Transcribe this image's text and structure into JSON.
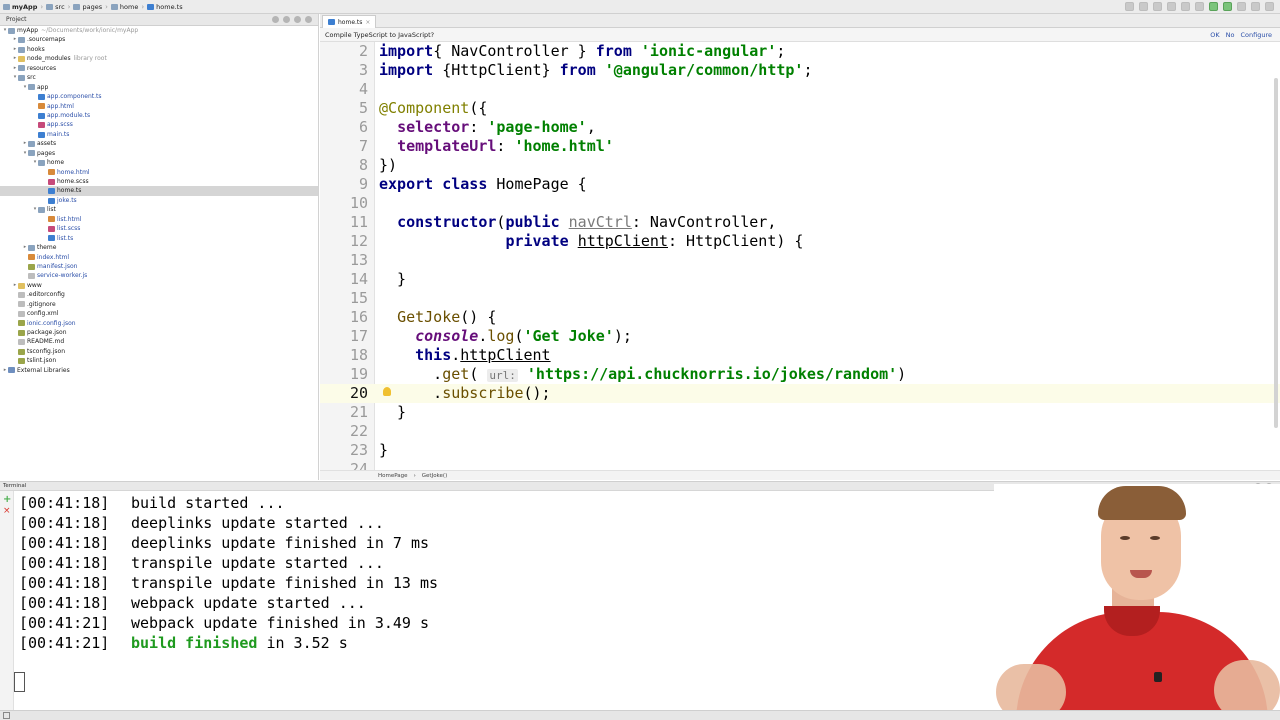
{
  "breadcrumb": [
    "myApp",
    "src",
    "pages",
    "home",
    "home.ts"
  ],
  "project": {
    "header": "Project",
    "tree": [
      {
        "label": "myApp",
        "sub": "~/Documents/work/ionic/myApp",
        "indent": 0,
        "arrow": "▾",
        "icon": "folder"
      },
      {
        "label": ".sourcemaps",
        "indent": 1,
        "arrow": "▸",
        "icon": "folder"
      },
      {
        "label": "hooks",
        "indent": 1,
        "arrow": "▸",
        "icon": "folder"
      },
      {
        "label": "node_modules",
        "sub": "library root",
        "indent": 1,
        "arrow": "▸",
        "icon": "folder-yellow"
      },
      {
        "label": "resources",
        "indent": 1,
        "arrow": "▸",
        "icon": "folder"
      },
      {
        "label": "src",
        "indent": 1,
        "arrow": "▾",
        "icon": "folder"
      },
      {
        "label": "app",
        "indent": 2,
        "arrow": "▾",
        "icon": "folder"
      },
      {
        "label": "app.component.ts",
        "indent": 3,
        "arrow": "",
        "icon": "ts",
        "blue": true
      },
      {
        "label": "app.html",
        "indent": 3,
        "arrow": "",
        "icon": "html",
        "blue": true
      },
      {
        "label": "app.module.ts",
        "indent": 3,
        "arrow": "",
        "icon": "ts",
        "blue": true
      },
      {
        "label": "app.scss",
        "indent": 3,
        "arrow": "",
        "icon": "scss",
        "blue": true
      },
      {
        "label": "main.ts",
        "indent": 3,
        "arrow": "",
        "icon": "ts",
        "blue": true
      },
      {
        "label": "assets",
        "indent": 2,
        "arrow": "▸",
        "icon": "folder"
      },
      {
        "label": "pages",
        "indent": 2,
        "arrow": "▾",
        "icon": "folder"
      },
      {
        "label": "home",
        "indent": 3,
        "arrow": "▾",
        "icon": "folder"
      },
      {
        "label": "home.html",
        "indent": 4,
        "arrow": "",
        "icon": "html",
        "blue": true
      },
      {
        "label": "home.scss",
        "indent": 4,
        "arrow": "",
        "icon": "scss"
      },
      {
        "label": "home.ts",
        "indent": 4,
        "arrow": "",
        "icon": "ts",
        "selected": true
      },
      {
        "label": "joke.ts",
        "indent": 4,
        "arrow": "",
        "icon": "ts",
        "blue": true
      },
      {
        "label": "list",
        "indent": 3,
        "arrow": "▾",
        "icon": "folder"
      },
      {
        "label": "list.html",
        "indent": 4,
        "arrow": "",
        "icon": "html",
        "blue": true
      },
      {
        "label": "list.scss",
        "indent": 4,
        "arrow": "",
        "icon": "scss",
        "blue": true
      },
      {
        "label": "list.ts",
        "indent": 4,
        "arrow": "",
        "icon": "ts",
        "blue": true
      },
      {
        "label": "theme",
        "indent": 2,
        "arrow": "▸",
        "icon": "folder"
      },
      {
        "label": "index.html",
        "indent": 2,
        "arrow": "",
        "icon": "html",
        "blue": true
      },
      {
        "label": "manifest.json",
        "indent": 2,
        "arrow": "",
        "icon": "json",
        "blue": true
      },
      {
        "label": "service-worker.js",
        "indent": 2,
        "arrow": "",
        "icon": "file",
        "blue": true
      },
      {
        "label": "www",
        "indent": 1,
        "arrow": "▸",
        "icon": "folder-yellow"
      },
      {
        "label": ".editorconfig",
        "indent": 1,
        "arrow": "",
        "icon": "file"
      },
      {
        "label": ".gitignore",
        "indent": 1,
        "arrow": "",
        "icon": "file"
      },
      {
        "label": "config.xml",
        "indent": 1,
        "arrow": "",
        "icon": "file"
      },
      {
        "label": "ionic.config.json",
        "indent": 1,
        "arrow": "",
        "icon": "json",
        "blue": true
      },
      {
        "label": "package.json",
        "indent": 1,
        "arrow": "",
        "icon": "json"
      },
      {
        "label": "README.md",
        "indent": 1,
        "arrow": "",
        "icon": "file"
      },
      {
        "label": "tsconfig.json",
        "indent": 1,
        "arrow": "",
        "icon": "json"
      },
      {
        "label": "tslint.json",
        "indent": 1,
        "arrow": "",
        "icon": "json"
      },
      {
        "label": "External Libraries",
        "indent": 0,
        "arrow": "▸",
        "icon": "lib"
      }
    ]
  },
  "editor": {
    "tab": "home.ts",
    "notice": {
      "text": "Compile TypeScript to JavaScript?",
      "ok": "OK",
      "no": "No",
      "configure": "Configure"
    },
    "breadcrumb": [
      "HomePage",
      "GetJoke()"
    ]
  },
  "code": [
    {
      "n": "2",
      "parts": [
        [
          "kw",
          "import"
        ],
        [
          "",
          "{ NavController } "
        ],
        [
          "kw",
          "from"
        ],
        [
          "",
          " "
        ],
        [
          "str",
          "'ionic-angular'"
        ],
        [
          "",
          ";"
        ]
      ]
    },
    {
      "n": "3",
      "parts": [
        [
          "kw",
          "import"
        ],
        [
          "",
          " {HttpClient} "
        ],
        [
          "kw",
          "from"
        ],
        [
          "",
          " "
        ],
        [
          "str",
          "'@angular/common/http'"
        ],
        [
          "",
          ";"
        ]
      ]
    },
    {
      "n": "4",
      "parts": []
    },
    {
      "n": "5",
      "parts": [
        [
          "dec",
          "@Component"
        ],
        [
          "",
          "({"
        ]
      ]
    },
    {
      "n": "6",
      "parts": [
        [
          "",
          "  "
        ],
        [
          "prop",
          "selector"
        ],
        [
          "",
          ": "
        ],
        [
          "str",
          "'page-home'"
        ],
        [
          "",
          ","
        ]
      ]
    },
    {
      "n": "7",
      "parts": [
        [
          "",
          "  "
        ],
        [
          "prop",
          "templateUrl"
        ],
        [
          "",
          ": "
        ],
        [
          "str",
          "'home.html'"
        ]
      ]
    },
    {
      "n": "8",
      "parts": [
        [
          "",
          "})"
        ]
      ]
    },
    {
      "n": "9",
      "parts": [
        [
          "kw",
          "export class"
        ],
        [
          "",
          " HomePage {"
        ]
      ]
    },
    {
      "n": "10",
      "parts": []
    },
    {
      "n": "11",
      "parts": [
        [
          "",
          "  "
        ],
        [
          "kw",
          "constructor"
        ],
        [
          "",
          "("
        ],
        [
          "kw",
          "public"
        ],
        [
          "",
          " "
        ],
        [
          "field-ul",
          "navCtrl"
        ],
        [
          "",
          ": NavController,"
        ]
      ]
    },
    {
      "n": "12",
      "parts": [
        [
          "",
          "              "
        ],
        [
          "kw",
          "private"
        ],
        [
          "",
          " "
        ],
        [
          "ul",
          "httpClient"
        ],
        [
          "",
          ": HttpClient) {"
        ]
      ]
    },
    {
      "n": "13",
      "parts": []
    },
    {
      "n": "14",
      "parts": [
        [
          "",
          "  }"
        ]
      ]
    },
    {
      "n": "15",
      "parts": []
    },
    {
      "n": "16",
      "parts": [
        [
          "",
          "  "
        ],
        [
          "fn",
          "GetJoke"
        ],
        [
          "",
          "() {"
        ]
      ]
    },
    {
      "n": "17",
      "parts": [
        [
          "",
          "    "
        ],
        [
          "it",
          "console"
        ],
        [
          "",
          "."
        ],
        [
          "fn",
          "log"
        ],
        [
          "",
          "("
        ],
        [
          "str",
          "'Get Joke'"
        ],
        [
          "",
          ");"
        ]
      ]
    },
    {
      "n": "18",
      "parts": [
        [
          "",
          "    "
        ],
        [
          "kw",
          "this"
        ],
        [
          "",
          "."
        ],
        [
          "ul",
          "httpClient"
        ]
      ]
    },
    {
      "n": "19",
      "parts": [
        [
          "",
          "      ."
        ],
        [
          "fn",
          "get"
        ],
        [
          "",
          "( "
        ],
        [
          "hint",
          "url:"
        ],
        [
          "",
          " "
        ],
        [
          "str",
          "'https://api.chucknorris.io/jokes/random'"
        ],
        [
          "",
          ")"
        ]
      ]
    },
    {
      "n": "20",
      "parts": [
        [
          "",
          "      ."
        ],
        [
          "fn",
          "subscribe"
        ],
        [
          "",
          "();"
        ]
      ],
      "current": true
    },
    {
      "n": "21",
      "parts": [
        [
          "",
          "  }"
        ]
      ]
    },
    {
      "n": "22",
      "parts": []
    },
    {
      "n": "23",
      "parts": [
        [
          "",
          "}"
        ]
      ]
    },
    {
      "n": "24",
      "parts": []
    }
  ],
  "terminal": {
    "title": "Terminal",
    "lines": [
      {
        "time": "[00:41:18]",
        "pre": "build started ...",
        "ok": "",
        "post": ""
      },
      {
        "time": "[00:41:18]",
        "pre": "deeplinks update started ...",
        "ok": "",
        "post": ""
      },
      {
        "time": "[00:41:18]",
        "pre": "deeplinks update finished in 7 ms",
        "ok": "",
        "post": ""
      },
      {
        "time": "[00:41:18]",
        "pre": "transpile update started ...",
        "ok": "",
        "post": ""
      },
      {
        "time": "[00:41:18]",
        "pre": "transpile update finished in 13 ms",
        "ok": "",
        "post": ""
      },
      {
        "time": "[00:41:18]",
        "pre": "webpack update started ...",
        "ok": "",
        "post": ""
      },
      {
        "time": "[00:41:21]",
        "pre": "webpack update finished in 3.49 s",
        "ok": "",
        "post": ""
      },
      {
        "time": "[00:41:21]",
        "pre": "",
        "ok": "build finished",
        "post": " in 3.52 s"
      }
    ]
  },
  "colors": {
    "keyword": "#000080",
    "string": "#008000",
    "success": "#1f9a1f",
    "shirt": "#d42a2a"
  }
}
